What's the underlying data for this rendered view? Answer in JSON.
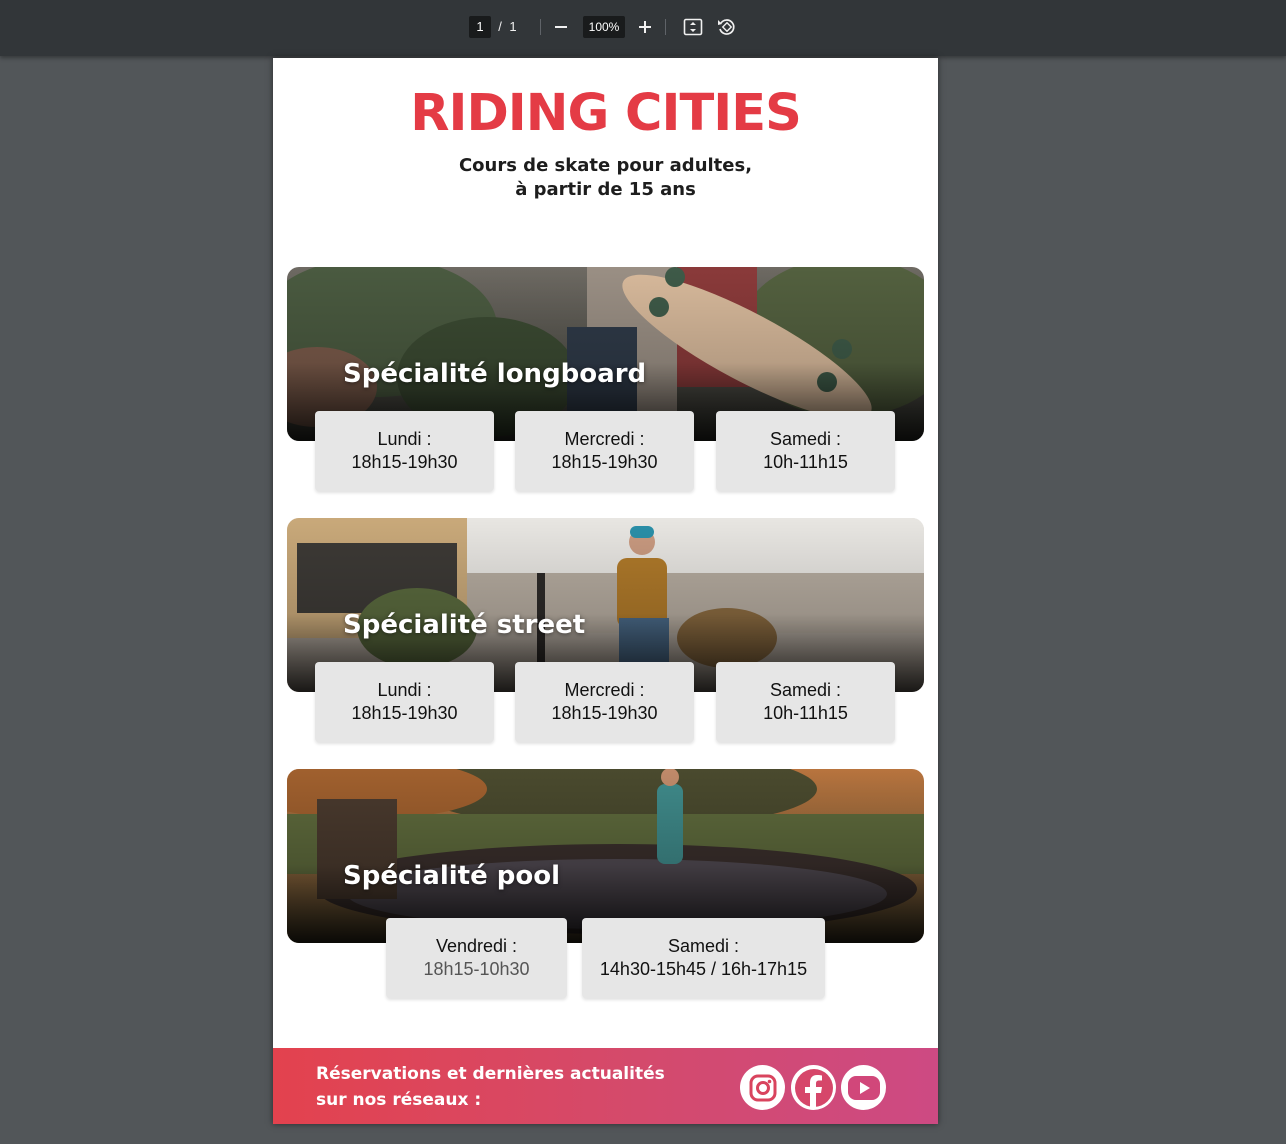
{
  "toolbar": {
    "page_current": "1",
    "page_separator": "/",
    "page_total": "1",
    "zoom_out_icon": "minus-icon",
    "zoom_level": "100%",
    "zoom_in_icon": "plus-icon",
    "fit_icon": "fit-page-icon",
    "rotate_icon": "rotate-icon"
  },
  "document": {
    "title": "RIDING CITIES",
    "subtitle_line1": "Cours de skate pour adultes,",
    "subtitle_line2": "à partir de 15 ans",
    "sections": [
      {
        "title": "Spécialité longboard",
        "slots": [
          {
            "day": "Lundi :",
            "time": "18h15-19h30"
          },
          {
            "day": "Mercredi :",
            "time": "18h15-19h30"
          },
          {
            "day": "Samedi :",
            "time": "10h-11h15"
          }
        ]
      },
      {
        "title": "Spécialité street",
        "slots": [
          {
            "day": "Lundi :",
            "time": "18h15-19h30"
          },
          {
            "day": "Mercredi :",
            "time": "18h15-19h30"
          },
          {
            "day": "Samedi :",
            "time": "10h-11h15"
          }
        ]
      },
      {
        "title": "Spécialité pool",
        "slots": [
          {
            "day": "Vendredi :",
            "time": "18h15-10h30"
          },
          {
            "day": "Samedi :",
            "time": "14h30-15h45 / 16h-17h15"
          }
        ]
      }
    ],
    "footer": {
      "line1": "Réservations et dernières actualités",
      "line2": "sur nos réseaux :",
      "icons": [
        "instagram-icon",
        "facebook-icon",
        "youtube-icon"
      ]
    }
  },
  "colors": {
    "toolbar_bg": "#323639",
    "viewer_bg": "#525659",
    "title_red": "#e43b45",
    "footer_gradient_start": "#e3424e",
    "footer_gradient_end": "#cd4a83",
    "slot_bg": "#e6e6e6"
  }
}
